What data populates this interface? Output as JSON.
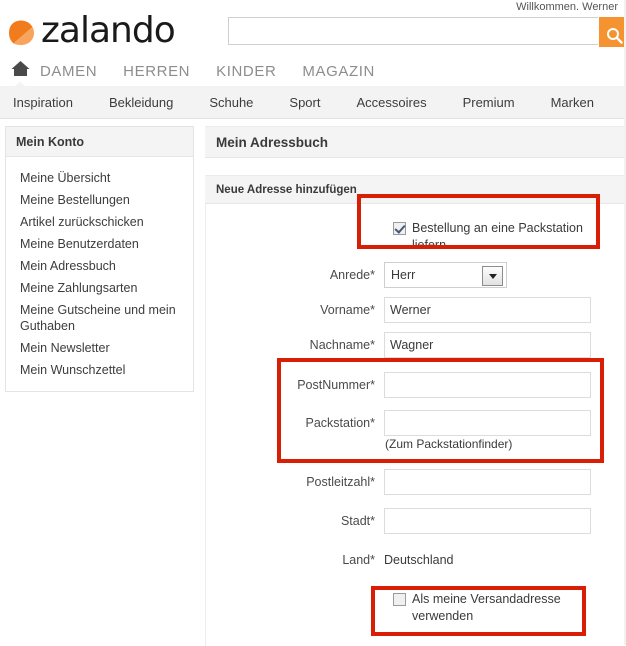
{
  "header": {
    "welcome": "Willkommen, Werner",
    "logo_word": "zalando",
    "logo_mark_icon": "zalando-triangle-logo",
    "search": {
      "value": "",
      "placeholder": "",
      "button_icon": "search-icon"
    }
  },
  "mainnav": {
    "home_icon": "home-icon",
    "items": [
      {
        "label": "DAMEN"
      },
      {
        "label": "HERREN"
      },
      {
        "label": "KINDER"
      },
      {
        "label": "MAGAZIN"
      }
    ]
  },
  "subnav": {
    "items": [
      {
        "label": "Inspiration"
      },
      {
        "label": "Bekleidung"
      },
      {
        "label": "Schuhe"
      },
      {
        "label": "Sport"
      },
      {
        "label": "Accessoires"
      },
      {
        "label": "Premium"
      },
      {
        "label": "Marken"
      }
    ]
  },
  "sidebar": {
    "title": "Mein Konto",
    "items": [
      {
        "label": "Meine Übersicht"
      },
      {
        "label": "Meine Bestellungen"
      },
      {
        "label": "Artikel zurückschicken"
      },
      {
        "label": "Meine Benutzerdaten"
      },
      {
        "label": "Mein Adressbuch"
      },
      {
        "label": "Meine Zahlungsarten"
      },
      {
        "label": "Meine Gutscheine und mein Guthaben"
      },
      {
        "label": "Mein Newsletter"
      },
      {
        "label": "Mein Wunschzettel"
      }
    ]
  },
  "content": {
    "page_title": "Mein Adressbuch",
    "panel_title": "Neue Adresse hinzufügen",
    "packstation_checkbox": {
      "label": "Bestellung an eine Packstation liefern.",
      "checked": true
    },
    "fields": [
      {
        "label": "Anrede*",
        "type": "select",
        "value": "Herr"
      },
      {
        "label": "Vorname*",
        "type": "text",
        "value": "Werner"
      },
      {
        "label": "Nachname*",
        "type": "text",
        "value": "Wagner"
      },
      {
        "label": "PostNummer*",
        "type": "text",
        "value": ""
      },
      {
        "label": "Packstation*",
        "type": "text",
        "value": ""
      },
      {
        "label": "Postleitzahl*",
        "type": "text",
        "value": ""
      },
      {
        "label": "Stadt*",
        "type": "text",
        "value": ""
      },
      {
        "label": "Land*",
        "type": "static",
        "value": "Deutschland"
      }
    ],
    "packstation_hint": "(Zum Packstationfinder)",
    "shipping_checkbox": {
      "label": "Als meine Versandadresse verwenden",
      "checked": false
    }
  },
  "annotations": {
    "color": "#d81e05",
    "boxes": [
      {
        "name": "packstation-checkbox"
      },
      {
        "name": "packstation-fields"
      },
      {
        "name": "shipping-checkbox"
      }
    ]
  }
}
